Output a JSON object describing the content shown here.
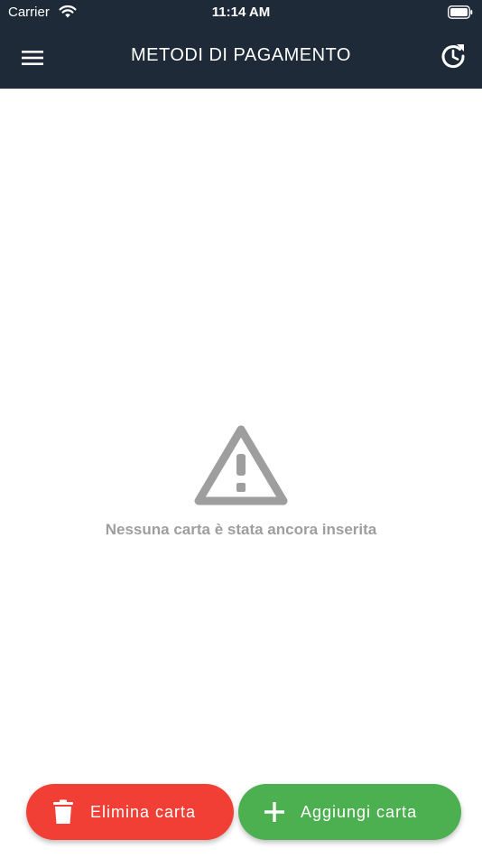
{
  "status_bar": {
    "carrier": "Carrier",
    "time": "11:14 AM"
  },
  "app_bar": {
    "title": "METODI DI PAGAMENTO",
    "menu_icon": "menu-icon",
    "refresh_icon": "refresh-icon"
  },
  "empty_state": {
    "icon": "warning-icon",
    "message": "Nessuna carta è stata ancora inserita"
  },
  "actions": {
    "delete_label": "Elimina carta",
    "add_label": "Aggiungi carta"
  },
  "colors": {
    "header_bg": "#1e2a38",
    "delete_bg": "#f23f36",
    "add_bg": "#4caf50",
    "empty_text": "#9e9e9e"
  }
}
